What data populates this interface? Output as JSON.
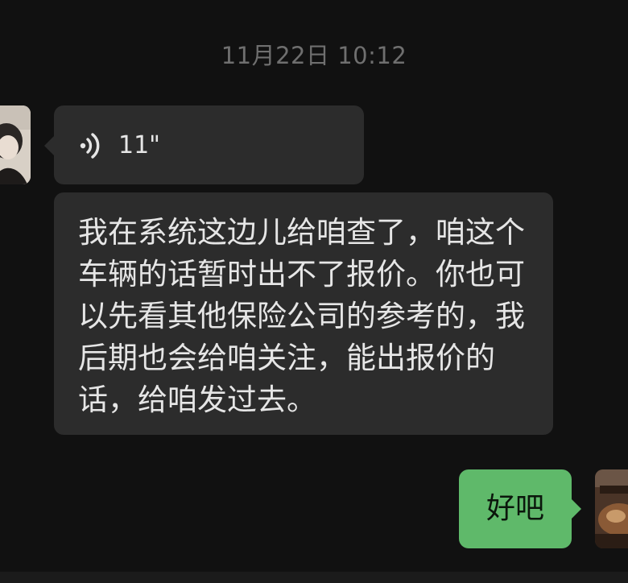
{
  "chat": {
    "timestamp": "11月22日 10:12",
    "messages": [
      {
        "side": "left",
        "type": "voice",
        "duration": "11\"",
        "icon": "voice-wave-icon"
      },
      {
        "side": "left",
        "type": "text",
        "text": "我在系统这边儿给咱查了，咱这个车辆的话暂时出不了报价。你也可以先看其他保险公司的参考的，我后期也会给咱关注，能出报价的话，给咱发过去。"
      },
      {
        "side": "right",
        "type": "text",
        "text": "好吧"
      }
    ]
  },
  "colors": {
    "background": "#111111",
    "incoming_bubble": "#2c2c2c",
    "outgoing_bubble": "#5fb96a",
    "timestamp_text": "#6f6f6f",
    "message_text": "#e6e6e6"
  }
}
